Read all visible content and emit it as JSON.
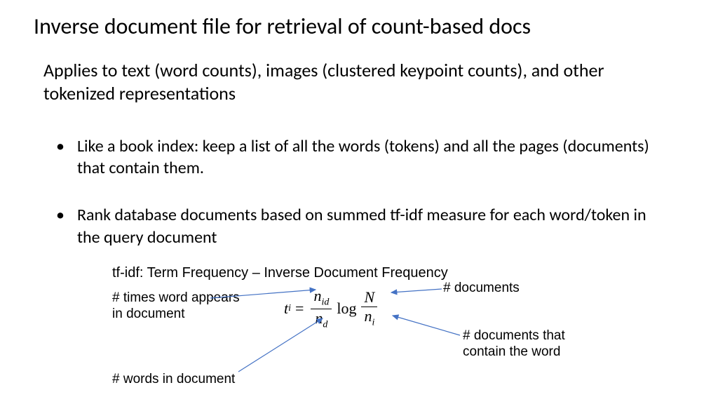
{
  "title": "Inverse document file for retrieval of count-based docs",
  "subtitle": "Applies to text (word counts), images (clustered keypoint counts), and other tokenized representations",
  "bullets": [
    "Like a book index: keep a list of all the words (tokens) and all the pages (documents) that contain them.",
    "Rank database documents based on summed tf-idf measure for each word/token in the query document"
  ],
  "tfidf_label": "tf-idf: Term Frequency – Inverse Document Frequency",
  "annotations": {
    "times_word": "# times word appears in document",
    "words_in_doc": "# words in document",
    "documents": "#  documents",
    "docs_contain": "#  documents that contain the word"
  },
  "formula": {
    "lhs_var": "t",
    "lhs_sub": "i",
    "eq": "=",
    "frac1_num_var": "n",
    "frac1_num_sub": "id",
    "frac1_den_var": "n",
    "frac1_den_sub": "d",
    "log": "log",
    "frac2_num": "N",
    "frac2_den_var": "n",
    "frac2_den_sub": "i"
  }
}
